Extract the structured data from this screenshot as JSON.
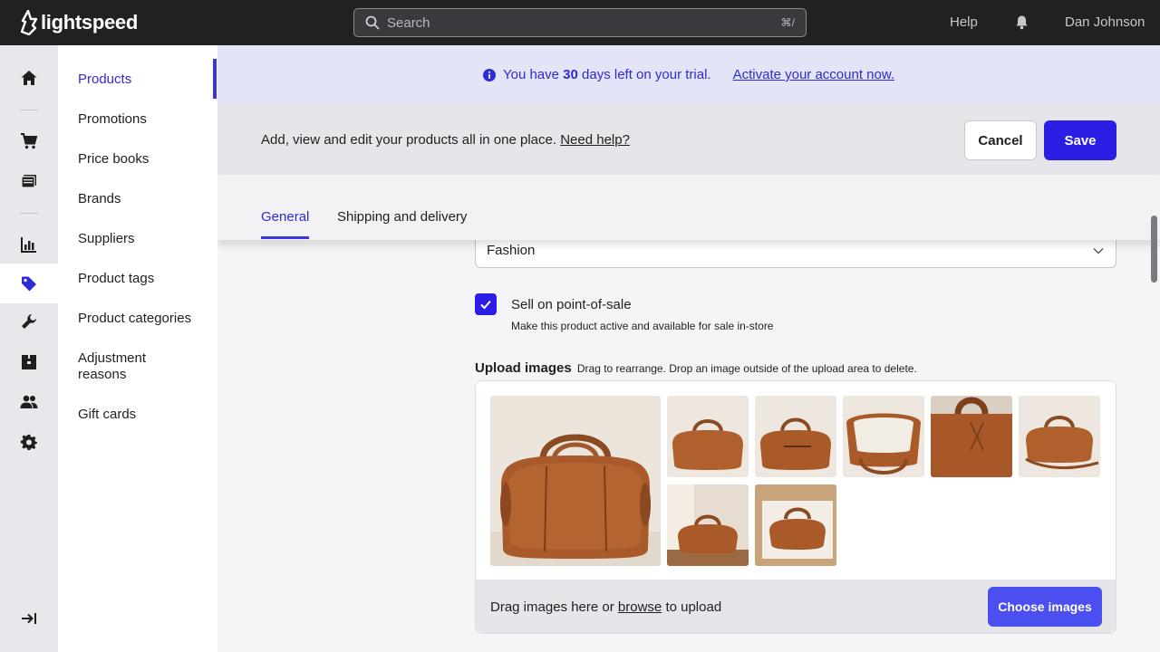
{
  "brand": {
    "name": "lightspeed"
  },
  "topbar": {
    "search_placeholder": "Search",
    "search_shortcut": "⌘/",
    "help_label": "Help",
    "user_name": "Dan Johnson"
  },
  "rail": {
    "items": [
      "home-icon",
      "cart-icon",
      "register-icon",
      "reports-icon",
      "products-tag-icon",
      "tools-icon",
      "inventory-icon",
      "customers-icon",
      "settings-icon"
    ],
    "active": "products-tag-icon",
    "collapse_icon": "collapse-arrow-icon"
  },
  "subnav": {
    "items": [
      {
        "label": "Products",
        "active": true
      },
      {
        "label": "Promotions"
      },
      {
        "label": "Price books"
      },
      {
        "label": "Brands"
      },
      {
        "label": "Suppliers"
      },
      {
        "label": "Product tags"
      },
      {
        "label": "Product categories"
      },
      {
        "label": "Adjustment reasons"
      },
      {
        "label": "Gift cards"
      }
    ]
  },
  "trial": {
    "prefix": "You have",
    "days": "30",
    "suffix": "days left on your trial.",
    "link": "Activate your account now."
  },
  "actionbar": {
    "text": "Add, view and edit your products all in one place.",
    "help_link": "Need help?",
    "cancel_label": "Cancel",
    "save_label": "Save"
  },
  "tabs": [
    {
      "label": "General",
      "active": true
    },
    {
      "label": "Shipping and delivery"
    }
  ],
  "form": {
    "category_value": "Fashion",
    "sell_pos_label": "Sell on point-of-sale",
    "sell_pos_checked": true,
    "sell_pos_sub": "Make this product active and available for sale in-store",
    "upload_title": "Upload images",
    "upload_hint": "Drag to rearrange. Drop an image outside of the upload area to delete.",
    "drop_prefix": "Drag images here or",
    "drop_browse": "browse",
    "drop_suffix": "to upload",
    "choose_label": "Choose images",
    "image_count": 8
  },
  "colors": {
    "accent": "#2c1fe5",
    "accent_text": "#2f2bd6",
    "topbar_bg": "#212124",
    "trial_bg": "#e3e4f7"
  }
}
